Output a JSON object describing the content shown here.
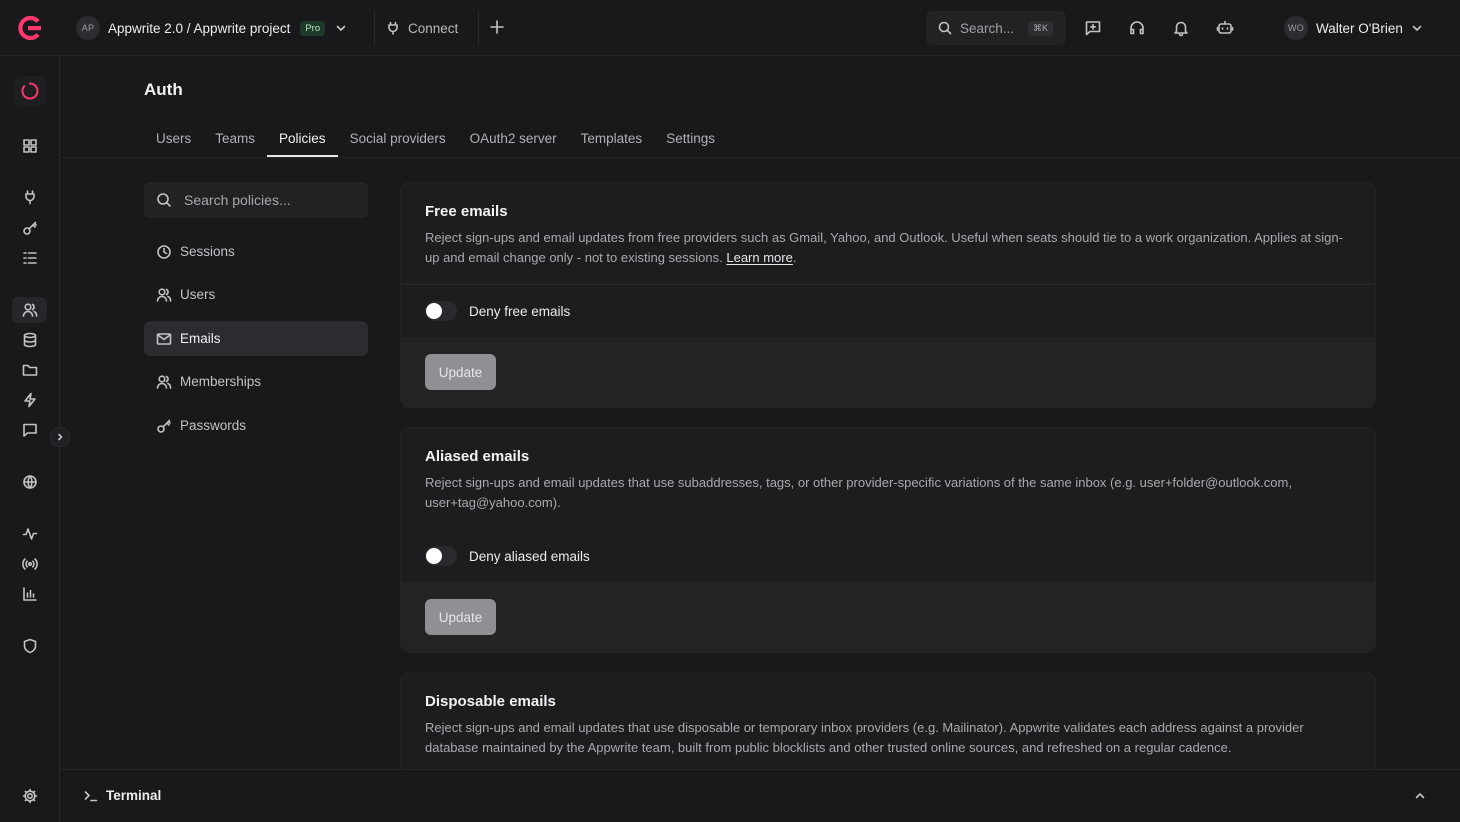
{
  "project": {
    "initials": "AP",
    "name": "Appwrite 2.0 / Appwrite project",
    "plan_badge": "Pro"
  },
  "topbar": {
    "connect_label": "Connect",
    "search_label": "Search...",
    "search_shortcut": "⌘K",
    "user_initials": "WO",
    "user_name": "Walter O'Brien"
  },
  "page": {
    "title": "Auth",
    "tabs": [
      {
        "label": "Users",
        "active": false
      },
      {
        "label": "Teams",
        "active": false
      },
      {
        "label": "Policies",
        "active": true
      },
      {
        "label": "Social providers",
        "active": false
      },
      {
        "label": "OAuth2 server",
        "active": false
      },
      {
        "label": "Templates",
        "active": false
      },
      {
        "label": "Settings",
        "active": false
      }
    ]
  },
  "policies_nav": {
    "search_placeholder": "Search policies...",
    "items": [
      {
        "label": "Sessions",
        "icon": "clock-icon",
        "active": false
      },
      {
        "label": "Users",
        "icon": "users-icon",
        "active": false
      },
      {
        "label": "Emails",
        "icon": "mail-icon",
        "active": true
      },
      {
        "label": "Memberships",
        "icon": "memberships-icon",
        "active": false
      },
      {
        "label": "Passwords",
        "icon": "key-icon",
        "active": false
      }
    ]
  },
  "cards": {
    "free": {
      "title": "Free emails",
      "description": "Reject sign-ups and email updates from free providers such as Gmail, Yahoo, and Outlook. Useful when seats should tie to a work organization. Applies at sign-up and email change only - not to existing sessions.",
      "link": "Learn more",
      "toggle_label": "Deny free emails",
      "toggle_on": false,
      "button": "Update"
    },
    "aliased": {
      "title": "Aliased emails",
      "description": "Reject sign-ups and email updates that use subaddresses, tags, or other provider-specific variations of the same inbox (e.g. user+folder@outlook.com, user+tag@yahoo.com).",
      "toggle_label": "Deny aliased emails",
      "toggle_on": false,
      "button": "Update"
    },
    "disposable": {
      "title": "Disposable emails",
      "description": "Reject sign-ups and email updates that use disposable or temporary inbox providers (e.g. Mailinator). Appwrite validates each address against a provider database maintained by the Appwrite team, built from public blocklists and other trusted online sources, and refreshed on a regular cadence."
    }
  },
  "terminal": {
    "label": "Terminal"
  },
  "colors": {
    "brand": "#fd366e",
    "background": "#19191c",
    "card": "#1d1d20",
    "button_disabled": "#8f8f94"
  }
}
